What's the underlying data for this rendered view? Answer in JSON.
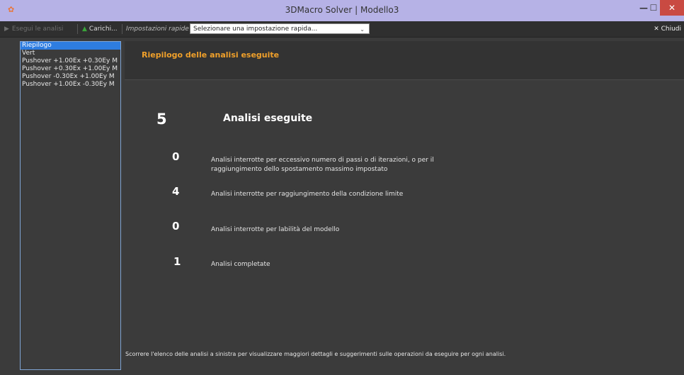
{
  "window": {
    "title": "3DMacro Solver | Modello3",
    "minimize_label": "—",
    "maximize_label": "☐",
    "close_label": "✕"
  },
  "toolbar": {
    "run_label": "Esegui le analisi",
    "load_label": "Carichi...",
    "quick_settings_label": "Impostazioni rapide",
    "quick_settings_value": "Selezionare una impostazione rapida...",
    "close_label": "✕ Chiudi"
  },
  "sidebar": {
    "items": [
      {
        "label": "Riepilogo",
        "selected": true
      },
      {
        "label": "Vert",
        "selected": false
      },
      {
        "label": "Pushover +1.00Ex +0.30Ey M",
        "selected": false
      },
      {
        "label": "Pushover +0.30Ex +1.00Ey M",
        "selected": false
      },
      {
        "label": "Pushover -0.30Ex +1.00Ey M",
        "selected": false
      },
      {
        "label": "Pushover +1.00Ex -0.30Ey M",
        "selected": false
      }
    ]
  },
  "main": {
    "header_title": "Riepilogo delle analisi eseguite",
    "total_count": "5",
    "total_label": "Analisi eseguite",
    "stats": [
      {
        "count": "0",
        "text_line1": "Analisi interrotte per eccessivo numero di passi o di iterazioni, o per il",
        "text_line2": "raggiungimento dello spostamento massimo impostato"
      },
      {
        "count": "4",
        "text_line1": "Analisi interrotte per raggiungimento della condizione limite",
        "text_line2": ""
      },
      {
        "count": "0",
        "text_line1": "Analisi interrotte per labilità del modello",
        "text_line2": ""
      },
      {
        "count": "1",
        "text_line1": "Analisi completate",
        "text_line2": ""
      }
    ],
    "footer_note": "Scorrere l'elenco delle analisi a sinistra per visualizzare maggiori dettagli e suggerimenti sulle operazioni da eseguire per ogni analisi."
  },
  "colors": {
    "accent": "#f0a02a",
    "selection": "#2e7de0",
    "titlebar": "#b6b2e6",
    "background": "#3b3b3b"
  }
}
